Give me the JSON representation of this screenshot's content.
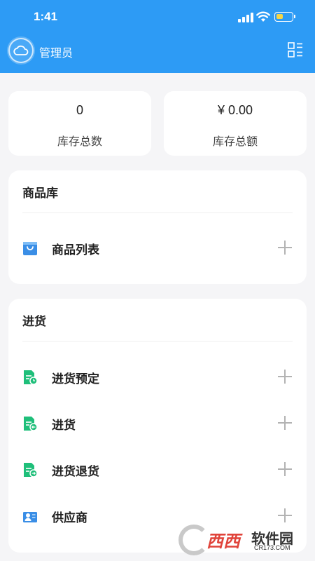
{
  "status_bar": {
    "time": "1:41"
  },
  "app_bar": {
    "title": "管理员"
  },
  "stats": [
    {
      "value": "0",
      "label": "库存总数"
    },
    {
      "value": "¥ 0.00",
      "label": "库存总额"
    }
  ],
  "sections": [
    {
      "title": "商品库",
      "items": [
        {
          "label": "商品列表",
          "icon": "product-bag-icon"
        }
      ]
    },
    {
      "title": "进货",
      "items": [
        {
          "label": "进货预定",
          "icon": "document-reserve-icon"
        },
        {
          "label": "进货",
          "icon": "document-receive-icon"
        },
        {
          "label": "进货退货",
          "icon": "document-return-icon"
        },
        {
          "label": "供应商",
          "icon": "supplier-icon"
        }
      ]
    }
  ],
  "colors": {
    "primary": "#2d9bf5",
    "green": "#1fbf7a",
    "blue": "#3a8ee6"
  },
  "watermark": {
    "brand": "西西",
    "suffix": "软件园",
    "domain": "CR173.COM"
  }
}
